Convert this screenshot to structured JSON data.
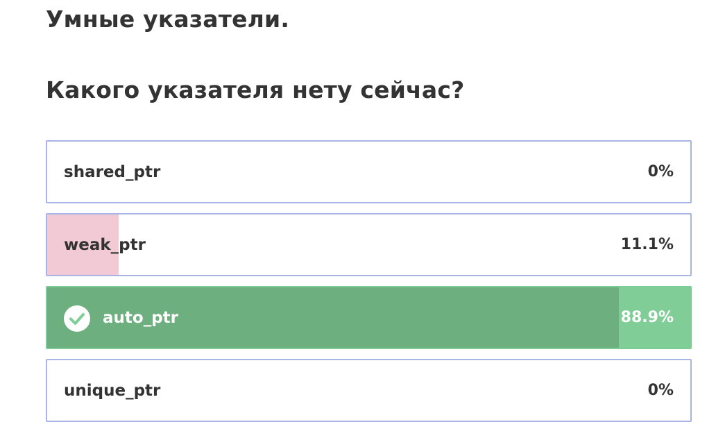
{
  "lesson_title": "Умные указатели.",
  "question": "Какого указателя нету сейчас?",
  "colors": {
    "border": "#a8b3e6",
    "wrong_fill": "#f1cad6",
    "correct_bg": "#81cd97",
    "correct_fill": "#6eaf80",
    "text": "#333333"
  },
  "options": [
    {
      "label": "shared_ptr",
      "percent": "0%",
      "share": 0,
      "correct": false
    },
    {
      "label": "weak_ptr",
      "percent": "11.1%",
      "share": 0.111,
      "correct": false
    },
    {
      "label": "auto_ptr",
      "percent": "88.9%",
      "share": 0.889,
      "correct": true,
      "icon": "check-circle-icon"
    },
    {
      "label": "unique_ptr",
      "percent": "0%",
      "share": 0,
      "correct": false
    }
  ]
}
